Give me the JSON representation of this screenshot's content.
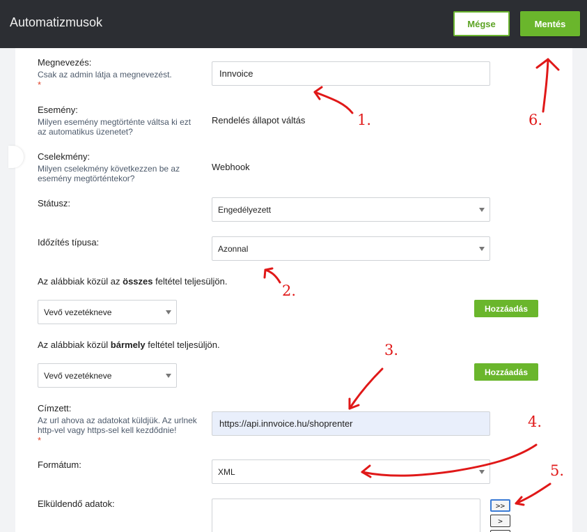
{
  "header": {
    "title": "Automatizmusok",
    "cancel_label": "Mégse",
    "save_label": "Mentés"
  },
  "form": {
    "name": {
      "label": "Megnevezés:",
      "help": "Csak az admin látja a megnevezést.",
      "required": "*",
      "value": "Innvoice"
    },
    "event": {
      "label": "Esemény:",
      "help_1": "Milyen esemény megtörténte váltsa ki ezt",
      "help_2": "az automatikus üzenetet?",
      "value": "Rendelés állapot váltás"
    },
    "action": {
      "label": "Cselekmény:",
      "help_1": "Milyen cselekmény következzen be az",
      "help_2": "esemény megtörténtekor?",
      "value": "Webhook"
    },
    "status": {
      "label": "Státusz:",
      "value": "Engedélyezett"
    },
    "timing": {
      "label": "Időzítés típusa:",
      "value": "Azonnal"
    },
    "all_conditions": {
      "prefix": "Az alábbiak közül az ",
      "bold": "összes",
      "suffix": " feltétel teljesüljön.",
      "select": "Vevő vezetékneve",
      "add_label": "Hozzáadás"
    },
    "any_conditions": {
      "prefix": "Az alábbiak közül ",
      "bold": "bármely",
      "suffix": " feltétel teljesüljön.",
      "select": "Vevő vezetékneve",
      "add_label": "Hozzáadás"
    },
    "recipient": {
      "label": "Címzett:",
      "help_1": "Az url ahova az adatokat küldjük. Az urlnek",
      "help_2": "http-vel vagy https-sel kell kezdődnie!",
      "required": "*",
      "value": "https://api.innvoice.hu/shoprenter"
    },
    "format": {
      "label": "Formátum:",
      "value": "XML"
    },
    "send_data": {
      "label": "Elküldendő adatok:",
      "btn_all": ">>",
      "btn_one": ">"
    }
  },
  "annotations": [
    "1.",
    "2.",
    "3.",
    "4.",
    "5.",
    "6."
  ],
  "colors": {
    "accent": "#6ab62c",
    "topbar": "#2c2e33",
    "annotation": "#e01818"
  }
}
